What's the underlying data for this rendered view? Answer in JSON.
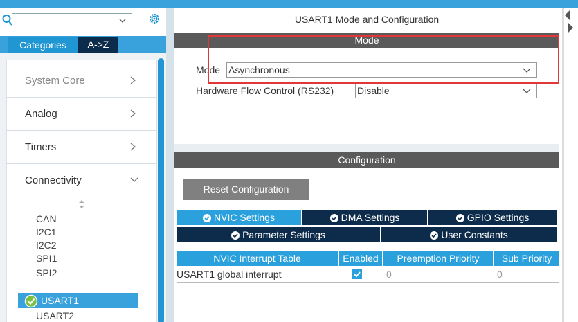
{
  "sidebar": {
    "search": {
      "value": "",
      "placeholder": ""
    },
    "tabs": {
      "categories": "Categories",
      "az": "A->Z"
    },
    "categories": [
      {
        "label": "System Core"
      },
      {
        "label": "Analog"
      },
      {
        "label": "Timers"
      },
      {
        "label": "Connectivity"
      }
    ],
    "peripherals": [
      "CAN",
      "I2C1",
      "I2C2",
      "SPI1",
      "SPI2",
      "USART1",
      "USART2"
    ]
  },
  "main": {
    "title": "USART1 Mode and Configuration",
    "mode": {
      "header": "Mode",
      "mode_label": "Mode",
      "mode_value": "Asynchronous",
      "hfc_label": "Hardware Flow Control (RS232)",
      "hfc_value": "Disable"
    },
    "configuration": {
      "header": "Configuration",
      "reset_label": "Reset Configuration",
      "tabs": {
        "nvic": "NVIC Settings",
        "dma": "DMA Settings",
        "gpio": "GPIO Settings",
        "parameter": "Parameter Settings",
        "user_constants": "User Constants"
      },
      "table": {
        "headers": [
          "NVIC Interrupt Table",
          "Enabled",
          "Preemption Priority",
          "Sub Priority"
        ],
        "rows": [
          {
            "name": "USART1 global interrupt",
            "enabled": true,
            "preemption": "0",
            "sub": "0"
          }
        ]
      }
    }
  },
  "colors": {
    "accent": "#2aa1dc",
    "dark_tab": "#0d2b4a",
    "header_gray": "#5a5a5a",
    "highlight": "#e03838"
  }
}
